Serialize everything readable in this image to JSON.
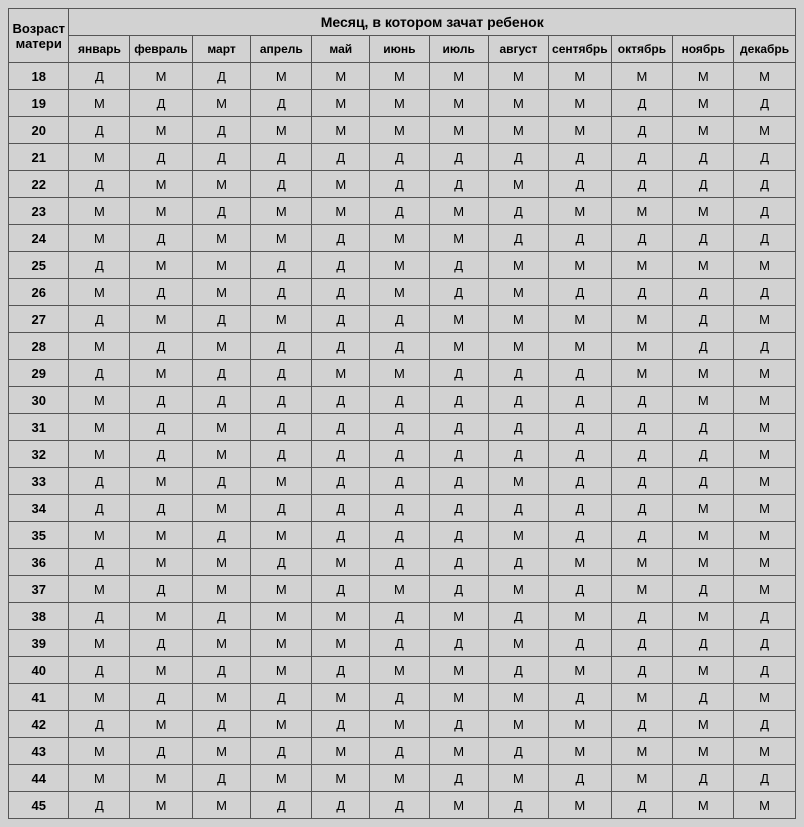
{
  "headers": {
    "age_label": "Возраст матери",
    "month_header": "Месяц, в котором зачат ребенок",
    "months": [
      "январь",
      "февраль",
      "март",
      "апрель",
      "май",
      "июнь",
      "июль",
      "август",
      "сентябрь",
      "октябрь",
      "ноябрь",
      "декабрь"
    ]
  },
  "chart_data": {
    "type": "table",
    "title": "Возраст матери × Месяц, в котором зачат ребенок",
    "row_label": "Возраст матери",
    "col_label": "Месяц, в котором зачат ребенок",
    "columns": [
      "январь",
      "февраль",
      "март",
      "апрель",
      "май",
      "июнь",
      "июль",
      "август",
      "сентябрь",
      "октябрь",
      "ноябрь",
      "декабрь"
    ],
    "rows": [
      {
        "age": 18,
        "values": [
          "Д",
          "М",
          "Д",
          "М",
          "М",
          "М",
          "М",
          "М",
          "М",
          "М",
          "М",
          "М"
        ]
      },
      {
        "age": 19,
        "values": [
          "М",
          "Д",
          "М",
          "Д",
          "М",
          "М",
          "М",
          "М",
          "М",
          "Д",
          "М",
          "Д"
        ]
      },
      {
        "age": 20,
        "values": [
          "Д",
          "М",
          "Д",
          "М",
          "М",
          "М",
          "М",
          "М",
          "М",
          "Д",
          "М",
          "М"
        ]
      },
      {
        "age": 21,
        "values": [
          "М",
          "Д",
          "Д",
          "Д",
          "Д",
          "Д",
          "Д",
          "Д",
          "Д",
          "Д",
          "Д",
          "Д"
        ]
      },
      {
        "age": 22,
        "values": [
          "Д",
          "М",
          "М",
          "Д",
          "М",
          "Д",
          "Д",
          "М",
          "Д",
          "Д",
          "Д",
          "Д"
        ]
      },
      {
        "age": 23,
        "values": [
          "М",
          "М",
          "Д",
          "М",
          "М",
          "Д",
          "М",
          "Д",
          "М",
          "М",
          "М",
          "Д"
        ]
      },
      {
        "age": 24,
        "values": [
          "М",
          "Д",
          "М",
          "М",
          "Д",
          "М",
          "М",
          "Д",
          "Д",
          "Д",
          "Д",
          "Д"
        ]
      },
      {
        "age": 25,
        "values": [
          "Д",
          "М",
          "М",
          "Д",
          "Д",
          "М",
          "Д",
          "М",
          "М",
          "М",
          "М",
          "М"
        ]
      },
      {
        "age": 26,
        "values": [
          "М",
          "Д",
          "М",
          "Д",
          "Д",
          "М",
          "Д",
          "М",
          "Д",
          "Д",
          "Д",
          "Д"
        ]
      },
      {
        "age": 27,
        "values": [
          "Д",
          "М",
          "Д",
          "М",
          "Д",
          "Д",
          "М",
          "М",
          "М",
          "М",
          "Д",
          "М"
        ]
      },
      {
        "age": 28,
        "values": [
          "М",
          "Д",
          "М",
          "Д",
          "Д",
          "Д",
          "М",
          "М",
          "М",
          "М",
          "Д",
          "Д"
        ]
      },
      {
        "age": 29,
        "values": [
          "Д",
          "М",
          "Д",
          "Д",
          "М",
          "М",
          "Д",
          "Д",
          "Д",
          "М",
          "М",
          "М"
        ]
      },
      {
        "age": 30,
        "values": [
          "М",
          "Д",
          "Д",
          "Д",
          "Д",
          "Д",
          "Д",
          "Д",
          "Д",
          "Д",
          "М",
          "М"
        ]
      },
      {
        "age": 31,
        "values": [
          "М",
          "Д",
          "М",
          "Д",
          "Д",
          "Д",
          "Д",
          "Д",
          "Д",
          "Д",
          "Д",
          "М"
        ]
      },
      {
        "age": 32,
        "values": [
          "М",
          "Д",
          "М",
          "Д",
          "Д",
          "Д",
          "Д",
          "Д",
          "Д",
          "Д",
          "Д",
          "М"
        ]
      },
      {
        "age": 33,
        "values": [
          "Д",
          "М",
          "Д",
          "М",
          "Д",
          "Д",
          "Д",
          "М",
          "Д",
          "Д",
          "Д",
          "М"
        ]
      },
      {
        "age": 34,
        "values": [
          "Д",
          "Д",
          "М",
          "Д",
          "Д",
          "Д",
          "Д",
          "Д",
          "Д",
          "Д",
          "М",
          "М"
        ]
      },
      {
        "age": 35,
        "values": [
          "М",
          "М",
          "Д",
          "М",
          "Д",
          "Д",
          "Д",
          "М",
          "Д",
          "Д",
          "М",
          "М"
        ]
      },
      {
        "age": 36,
        "values": [
          "Д",
          "М",
          "М",
          "Д",
          "М",
          "Д",
          "Д",
          "Д",
          "М",
          "М",
          "М",
          "М"
        ]
      },
      {
        "age": 37,
        "values": [
          "М",
          "Д",
          "М",
          "М",
          "Д",
          "М",
          "Д",
          "М",
          "Д",
          "М",
          "Д",
          "М"
        ]
      },
      {
        "age": 38,
        "values": [
          "Д",
          "М",
          "Д",
          "М",
          "М",
          "Д",
          "М",
          "Д",
          "М",
          "Д",
          "М",
          "Д"
        ]
      },
      {
        "age": 39,
        "values": [
          "М",
          "Д",
          "М",
          "М",
          "М",
          "Д",
          "Д",
          "М",
          "Д",
          "Д",
          "Д",
          "Д"
        ]
      },
      {
        "age": 40,
        "values": [
          "Д",
          "М",
          "Д",
          "М",
          "Д",
          "М",
          "М",
          "Д",
          "М",
          "Д",
          "М",
          "Д"
        ]
      },
      {
        "age": 41,
        "values": [
          "М",
          "Д",
          "М",
          "Д",
          "М",
          "Д",
          "М",
          "М",
          "Д",
          "М",
          "Д",
          "М"
        ]
      },
      {
        "age": 42,
        "values": [
          "Д",
          "М",
          "Д",
          "М",
          "Д",
          "М",
          "Д",
          "М",
          "М",
          "Д",
          "М",
          "Д"
        ]
      },
      {
        "age": 43,
        "values": [
          "М",
          "Д",
          "М",
          "Д",
          "М",
          "Д",
          "М",
          "Д",
          "М",
          "М",
          "М",
          "М"
        ]
      },
      {
        "age": 44,
        "values": [
          "М",
          "М",
          "Д",
          "М",
          "М",
          "М",
          "Д",
          "М",
          "Д",
          "М",
          "Д",
          "Д"
        ]
      },
      {
        "age": 45,
        "values": [
          "Д",
          "М",
          "М",
          "Д",
          "Д",
          "Д",
          "М",
          "Д",
          "М",
          "Д",
          "М",
          "М"
        ]
      }
    ]
  }
}
